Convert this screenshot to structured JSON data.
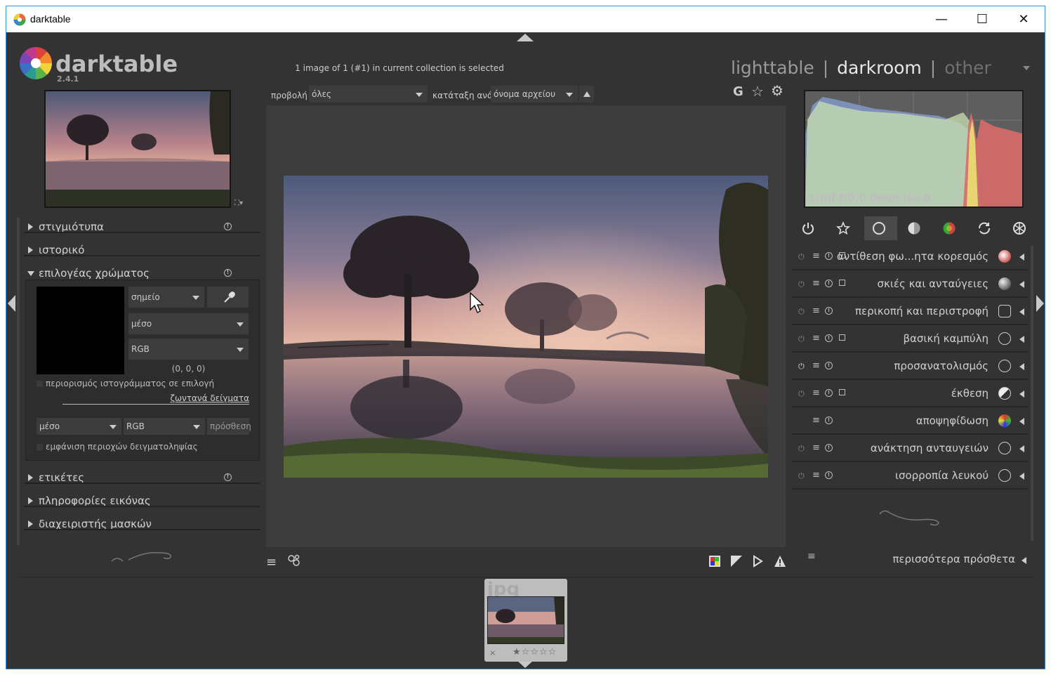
{
  "window": {
    "title": "darktable",
    "minimize": "—",
    "maximize": "☐",
    "close": "✕"
  },
  "logo": {
    "name": "darktable",
    "version": "2.4.1"
  },
  "header": {
    "status": "1 image of 1 (#1) in current collection is selected",
    "views": [
      {
        "label": "lighttable",
        "active": false
      },
      {
        "label": "darkroom",
        "active": true
      },
      {
        "label": "other",
        "active": false
      }
    ],
    "separator": "|"
  },
  "toolbar": {
    "view_label": "προβολή",
    "view_value": "όλες",
    "sort_label": "κατάταξη ανά",
    "sort_value": "όνομα αρχείου",
    "g_label": "G"
  },
  "left_panel": {
    "sections": [
      {
        "label": "στιγμιότυπα",
        "expanded": false,
        "info": true
      },
      {
        "label": "ιστορικό",
        "expanded": false,
        "info": false
      },
      {
        "label": "επιλογέας χρώματος",
        "expanded": true,
        "info": true
      },
      {
        "label": "ετικέτες",
        "expanded": false,
        "info": true
      },
      {
        "label": "πληροφορίες εικόνας",
        "expanded": false,
        "info": false
      },
      {
        "label": "διαχειριστής μασκών",
        "expanded": false,
        "info": false
      }
    ],
    "color_picker": {
      "mode": "σημείο",
      "stat": "μέσο",
      "colorspace": "RGB",
      "value": "(0, 0, 0)",
      "restrict_label": "περιορισμός ιστογράμματος σε επιλογή",
      "live_samples_label": "ζωντανά δείγματα",
      "sample_stat": "μέσο",
      "sample_colorspace": "RGB",
      "add_label": "πρόσθεση",
      "show_areas_label": "εμφάνιση περιοχών δειγματοληψίας"
    }
  },
  "histogram": {
    "exif": "1/inf f/0,0 0mm iso 0"
  },
  "modules": [
    {
      "label": "αντίθεση φω...ητα κορεσμός",
      "power": true,
      "presets": true,
      "multi": true
    },
    {
      "label": "σκιές και ανταύγειες",
      "power": true,
      "presets": true,
      "multi": true
    },
    {
      "label": "περικοπή και περιστροφή",
      "power": true,
      "presets": true,
      "multi": false
    },
    {
      "label": "βασική καμπύλη",
      "power": true,
      "presets": true,
      "multi": true
    },
    {
      "label": "προσανατολισμός",
      "power": true,
      "presets": true,
      "multi": false
    },
    {
      "label": "έκθεση",
      "power": true,
      "presets": true,
      "multi": true
    },
    {
      "label": "αποψηφίδωση",
      "power": false,
      "presets": true,
      "multi": false
    },
    {
      "label": "ανάκτηση ανταυγειών",
      "power": true,
      "presets": true,
      "multi": false
    },
    {
      "label": "ισορροπία λευκού",
      "power": true,
      "presets": true,
      "multi": false
    }
  ],
  "more_modules": "περισσότερα πρόσθετα",
  "filmstrip": {
    "ext": "jpg",
    "reject": "×",
    "stars": "★☆☆☆☆"
  },
  "colors": {
    "bg": "#333333",
    "panel": "#2a2a2a",
    "text": "#cfcfcf",
    "accent": "#3c8fd1"
  }
}
